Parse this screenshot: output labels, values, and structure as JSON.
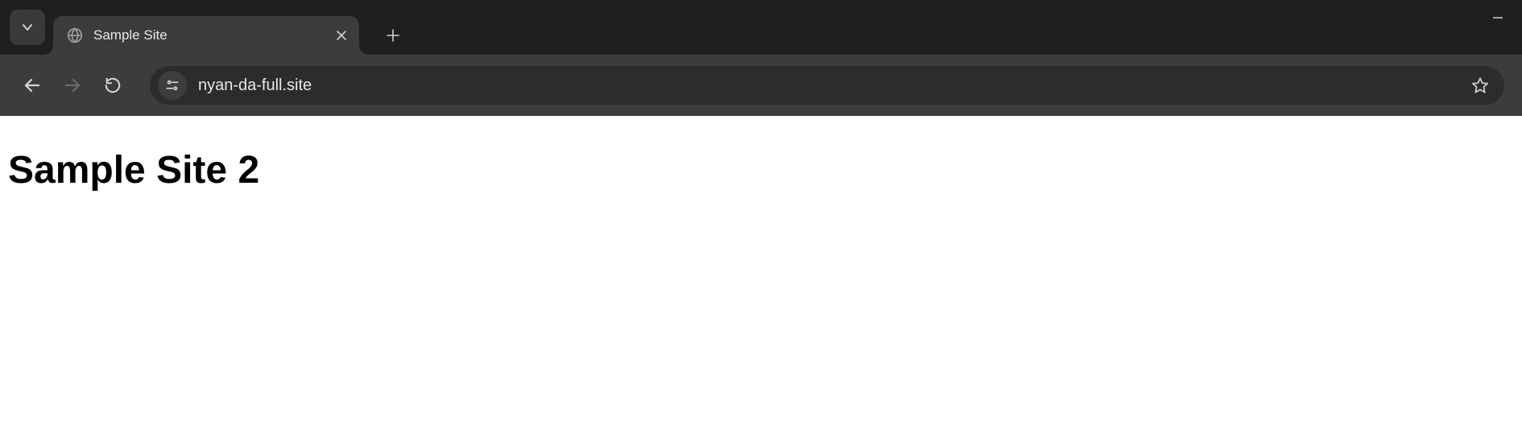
{
  "tab": {
    "title": "Sample Site"
  },
  "address_bar": {
    "url": "nyan-da-full.site"
  },
  "page": {
    "heading": "Sample Site 2"
  }
}
